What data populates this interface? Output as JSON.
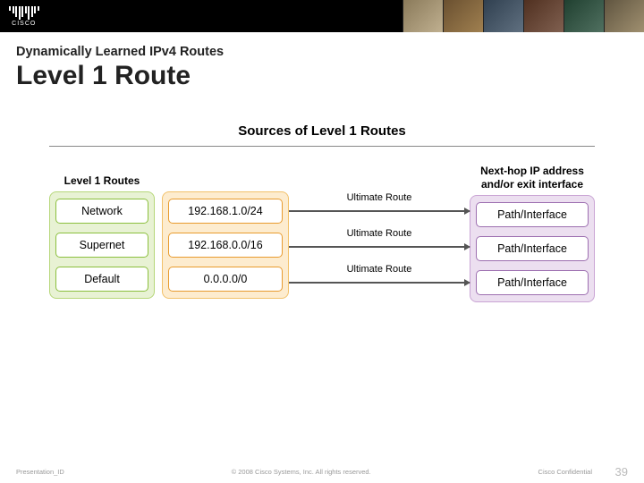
{
  "header": {
    "subtitle": "Dynamically Learned IPv4 Routes",
    "title": "Level 1 Route"
  },
  "diagram": {
    "title": "Sources of Level 1 Routes",
    "left_heading": "Level 1 Routes",
    "right_heading": "Next-hop IP address and/or exit interface",
    "arrow_label": "Ultimate Route",
    "rows": [
      {
        "type": "Network",
        "prefix": "192.168.1.0/24",
        "dest": "Path/Interface"
      },
      {
        "type": "Supernet",
        "prefix": "192.168.0.0/16",
        "dest": "Path/Interface"
      },
      {
        "type": "Default",
        "prefix": "0.0.0.0/0",
        "dest": "Path/Interface"
      }
    ]
  },
  "footer": {
    "presentation_id": "Presentation_ID",
    "copyright": "© 2008 Cisco Systems, Inc. All rights reserved.",
    "confidential": "Cisco Confidential",
    "page": "39"
  }
}
